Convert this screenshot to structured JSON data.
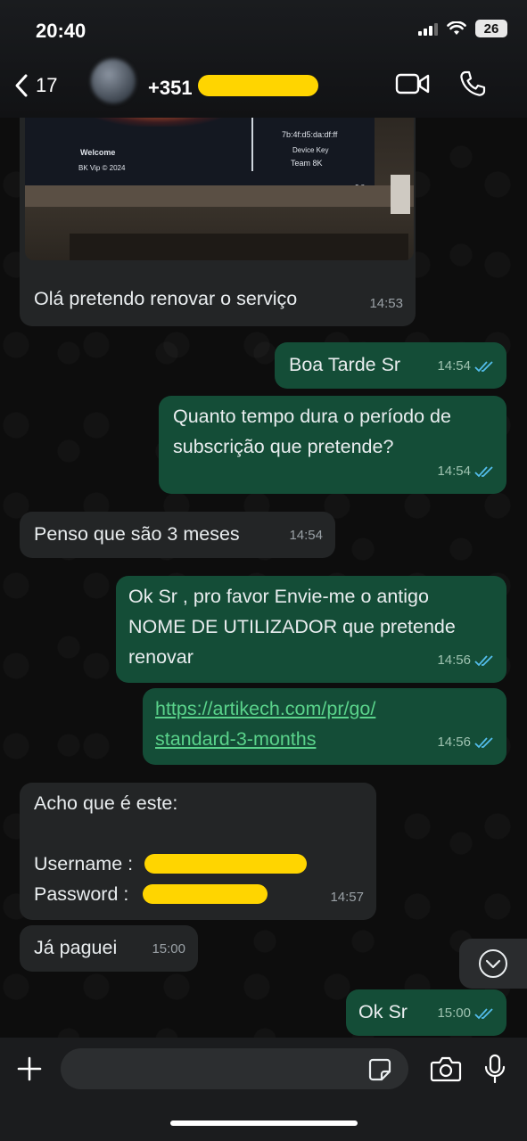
{
  "status_bar": {
    "time": "20:40",
    "battery": "26"
  },
  "header": {
    "back_count": "17",
    "contact_prefix": "+351"
  },
  "image_message": {
    "tv_welcome": "Welcome",
    "tv_brand": "BK Vip © 2024",
    "tv_mac": "7b:4f:d5:da:df:ff",
    "tv_device_key": "Device Key",
    "tv_team": "Team 8K",
    "tv_version": "v3.8",
    "caption": "Olá pretendo renovar o serviço",
    "time": "14:53"
  },
  "messages": [
    {
      "id": "m1",
      "dir": "out",
      "text": "Boa Tarde Sr",
      "time": "14:54"
    },
    {
      "id": "m2",
      "dir": "out",
      "line1": "Quanto tempo dura o período de",
      "line2": "subscrição que pretende?",
      "time": "14:54"
    },
    {
      "id": "m3",
      "dir": "in",
      "text": "Penso que são 3 meses",
      "time": "14:54"
    },
    {
      "id": "m4",
      "dir": "out",
      "line1": "Ok Sr , pro favor Envie-me o antigo",
      "line2": "NOME DE UTILIZADOR que pretende",
      "line3": "renovar",
      "time": "14:56"
    },
    {
      "id": "m5",
      "dir": "out",
      "link_line1": "https://artikech.com/pr/go/",
      "link_line2": "standard-3-months",
      "time": "14:56"
    },
    {
      "id": "m6",
      "dir": "in",
      "line1": "Acho que é este:",
      "username_label": "Username :",
      "password_label": "Password :",
      "time": "14:57"
    },
    {
      "id": "m7",
      "dir": "in",
      "text": "Já paguei",
      "time": "15:00"
    },
    {
      "id": "m8",
      "dir": "out",
      "text": "Ok Sr",
      "time": "15:00"
    }
  ],
  "composer": {
    "placeholder": ""
  },
  "colors": {
    "incoming": "#232526",
    "outgoing": "#144d37",
    "read_ticks": "#53bdeb",
    "redaction": "#ffd500",
    "link": "#5ad38b"
  },
  "icons": [
    "back-chevron-icon",
    "video-call-icon",
    "phone-icon",
    "double-check-icon",
    "scroll-down-icon",
    "plus-icon",
    "sticker-icon",
    "camera-icon",
    "microphone-icon"
  ]
}
